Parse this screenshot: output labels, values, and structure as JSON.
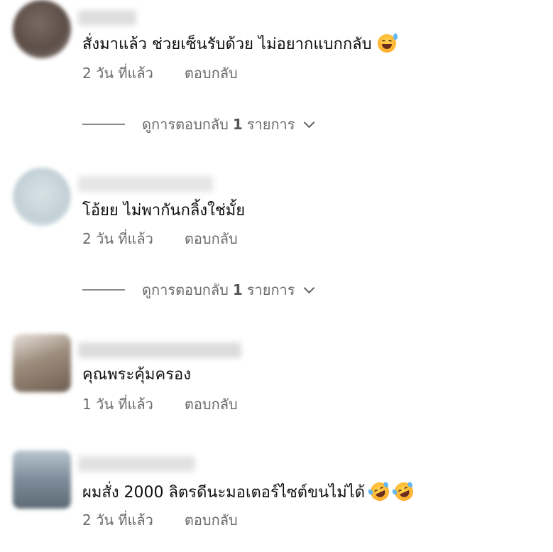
{
  "comments": [
    {
      "text": "สั่งมาแล้ว ช่วยเซ็นรับด้วย ไม่อยากแบกกลับ",
      "emojis": [
        "sweat-smile-emoji"
      ],
      "time": "2 วัน ที่แล้ว",
      "reply_label": "ตอบกลับ",
      "replies": {
        "prefix": "ดูการตอบกลับ",
        "count": "1",
        "suffix": "รายการ"
      },
      "avatar_color": "#6b5a52"
    },
    {
      "text": "โอ้ยย ไม่พากันกลิ้งใช่มั้ย",
      "emojis": [],
      "time": "2 วัน ที่แล้ว",
      "reply_label": "ตอบกลับ",
      "replies": {
        "prefix": "ดูการตอบกลับ",
        "count": "1",
        "suffix": "รายการ"
      },
      "avatar_color": "#c9d6db"
    },
    {
      "text": "คุณพระคุ้มครอง",
      "emojis": [],
      "time": "1 วัน ที่แล้ว",
      "reply_label": "ตอบกลับ",
      "avatar_color": "#8a7a6a"
    },
    {
      "text": "ผมสั่ง 2000 ลิตรดีนะมอเตอร์ไซต์ขนไม่ได้",
      "emojis": [
        "rolling-laughing-emoji",
        "rolling-laughing-emoji"
      ],
      "time": "2 วัน ที่แล้ว",
      "reply_label": "ตอบกลับ",
      "avatar_color": "#7c8c99"
    }
  ]
}
